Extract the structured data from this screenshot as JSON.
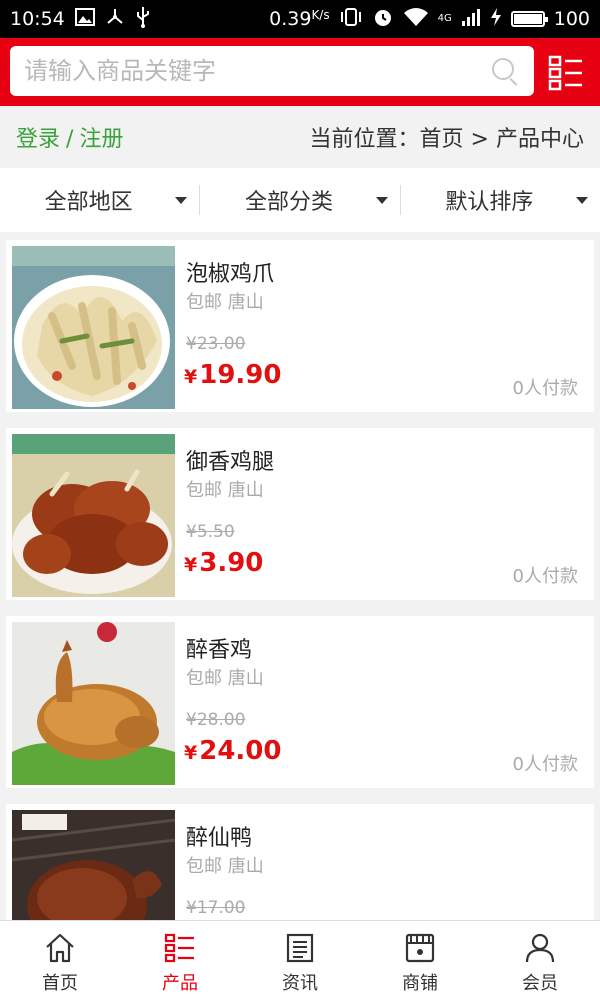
{
  "status_bar": {
    "time": "10:54",
    "speed": "0.39",
    "speed_unit": "K/s",
    "network": "4G",
    "battery": "100",
    "battery_level": 1.0,
    "left_icons": [
      "image-icon",
      "usb-hub-icon",
      "usb-icon"
    ],
    "right_icons": [
      "vibrate-icon",
      "alarm-icon",
      "wifi-icon",
      "signal-icon",
      "charging-icon"
    ]
  },
  "search": {
    "placeholder": "请输入商品关键字"
  },
  "location_bar": {
    "login": "登录",
    "separator": "/",
    "register": "注册",
    "location_prefix": "当前位置：",
    "crumb_home": "首页",
    "crumb_sep": ">",
    "crumb_current": "产品中心"
  },
  "filters": [
    {
      "label": "全部地区"
    },
    {
      "label": "全部分类"
    },
    {
      "label": "默认排序"
    }
  ],
  "products": [
    {
      "name": "泡椒鸡爪",
      "meta": "包邮 唐山",
      "old_price": "¥23.00",
      "currency": "¥",
      "price": "19.90",
      "buyers": "0人付款"
    },
    {
      "name": "御香鸡腿",
      "meta": "包邮 唐山",
      "old_price": "¥5.50",
      "currency": "¥",
      "price": "3.90",
      "buyers": "0人付款"
    },
    {
      "name": "醉香鸡",
      "meta": "包邮 唐山",
      "old_price": "¥28.00",
      "currency": "¥",
      "price": "24.00",
      "buyers": "0人付款"
    },
    {
      "name": "醉仙鸭",
      "meta": "包邮 唐山",
      "old_price": "¥17.00",
      "currency": "¥",
      "price": "",
      "buyers": ""
    }
  ],
  "tabbar": {
    "items": [
      {
        "label": "首页",
        "icon": "home-icon"
      },
      {
        "label": "产品",
        "icon": "product-list-icon"
      },
      {
        "label": "资讯",
        "icon": "news-icon"
      },
      {
        "label": "商铺",
        "icon": "shop-icon"
      },
      {
        "label": "会员",
        "icon": "member-icon"
      }
    ],
    "active_index": 1
  },
  "colors": {
    "brand_red": "#e60012",
    "price_red": "#e01010",
    "login_green": "#3aa33a"
  }
}
